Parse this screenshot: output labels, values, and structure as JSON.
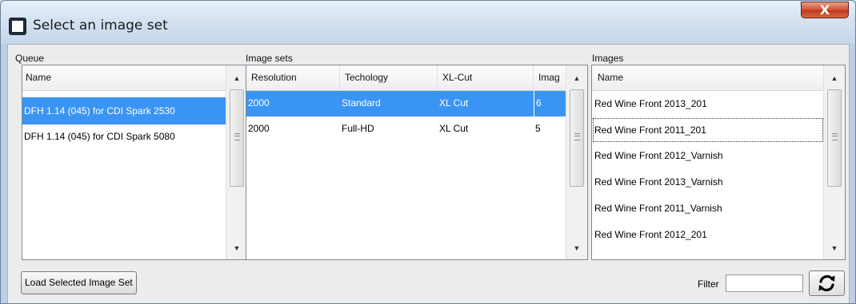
{
  "window": {
    "title": "Select an image set",
    "close_glyph": "X",
    "title_icon": "grid-window-icon"
  },
  "queue": {
    "label": "Queue",
    "header": "Name",
    "items": [
      {
        "name": "DFH 1.14 (045) for CDI Spark 2530",
        "selected": true
      },
      {
        "name": "DFH 1.14 (045) for CDI Spark 5080",
        "selected": false
      }
    ]
  },
  "image_sets": {
    "label": "Image sets",
    "columns": [
      "Resolution",
      "Techology",
      "XL-Cut",
      "Imag"
    ],
    "rows": [
      {
        "cells": [
          "2000",
          "Standard",
          "XL Cut",
          "6"
        ],
        "selected": true
      },
      {
        "cells": [
          "2000",
          "Full-HD",
          "XL Cut",
          "5"
        ],
        "selected": false
      }
    ]
  },
  "images": {
    "label": "Images",
    "header": "Name",
    "items": [
      {
        "name": "Red Wine Front 2013_201",
        "focused": false
      },
      {
        "name": "Red Wine Front 2011_201",
        "focused": true
      },
      {
        "name": "Red Wine Front 2012_Varnish",
        "focused": false
      },
      {
        "name": "Red Wine Front 2013_Varnish",
        "focused": false
      },
      {
        "name": "Red Wine Front 2011_Varnish",
        "focused": false
      },
      {
        "name": "Red Wine Front 2012_201",
        "focused": false
      }
    ]
  },
  "footer": {
    "load_button": "Load Selected Image Set",
    "filter_label": "Filter",
    "filter_value": "",
    "refresh_icon": "refresh-icon"
  },
  "colors": {
    "selection": "#3a94f3",
    "close_button": "#c9472a"
  }
}
